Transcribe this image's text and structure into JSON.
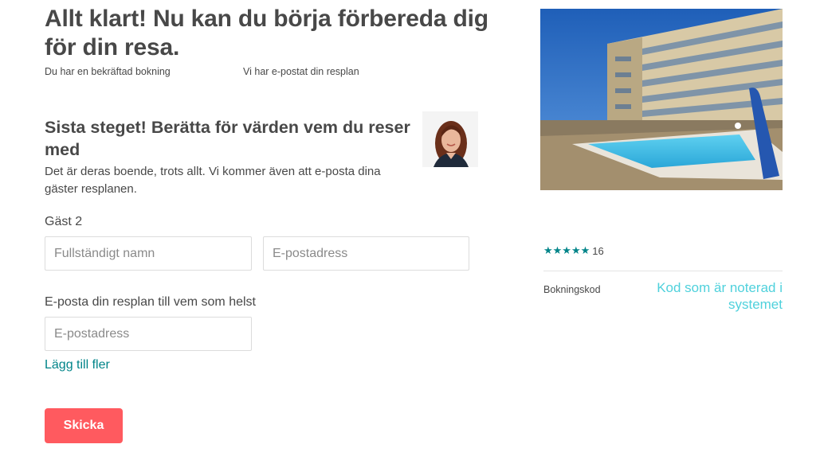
{
  "header": {
    "title": "Allt klart! Nu kan du börja förbereda dig för din resa.",
    "status_booking": "Du har en bekräftad bokning",
    "status_email": "Vi har e-postat din resplan"
  },
  "guest_step": {
    "title": "Sista steget! Berätta för värden vem du reser med",
    "description": "Det är deras boende, trots allt. Vi kommer även att e-posta dina gäster resplanen.",
    "guest_label": "Gäst 2",
    "name_placeholder": "Fullständigt namn",
    "email_placeholder": "E-postadress",
    "email_anyone_label": "E-posta din resplan till vem som helst",
    "extra_email_placeholder": "E-postadress",
    "add_more_label": "Lägg till fler",
    "submit_label": "Skicka"
  },
  "listing": {
    "stars": "★★★★★",
    "rating": 4.5,
    "review_count": "16",
    "booking_code_label": "Bokningskod",
    "booking_code_value": "Kod som är noterad i systemet"
  },
  "colors": {
    "accent": "#ff5a5f",
    "link": "#008489",
    "star": "#008489",
    "code": "#4fd1dc",
    "text": "#484848"
  }
}
